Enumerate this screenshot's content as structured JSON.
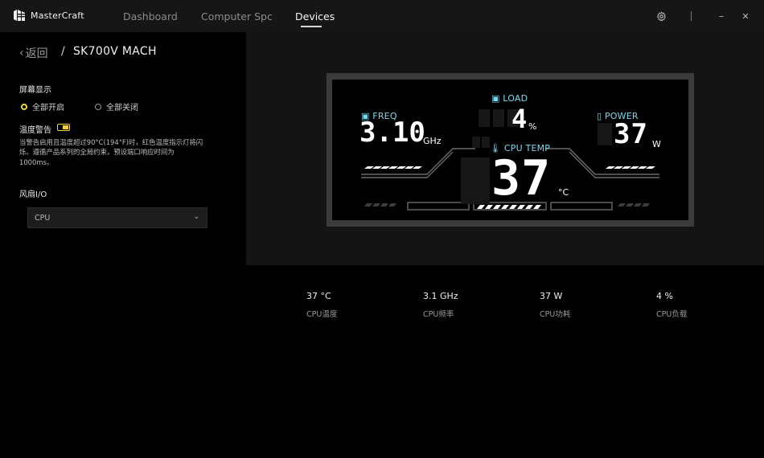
{
  "app": {
    "name": "MasterCraft"
  },
  "nav": {
    "dashboard": "Dashboard",
    "computer_spc": "Computer Spc",
    "devices": "Devices"
  },
  "window": {
    "settings_icon": "gear-icon",
    "minimize": "–",
    "close": "✕"
  },
  "breadcrumb": {
    "back": "返回",
    "separator": "/",
    "device": "SK700V MACH"
  },
  "screen_display": {
    "title": "屏幕显示",
    "option_on": "全部开启",
    "option_off": "全部关闭",
    "selected": "全部开启"
  },
  "temp_warning": {
    "title": "温度警告",
    "enabled": true,
    "description": "当警告启用且温度超过90°C(194°F)时，红色温度指示灯将闪烁。遵循产品系列的全局约束，预设端口响应时间为1000ms。"
  },
  "fan_io": {
    "title": "风扇I/O",
    "selected": "CPU"
  },
  "lcd": {
    "freq_label": "FREQ",
    "freq_value": "3.10",
    "freq_unit": "GHz",
    "load_label": "LOAD",
    "load_value": "4",
    "load_unit": "%",
    "power_label": "POWER",
    "power_value": "37",
    "power_unit": "W",
    "temp_label": "CPU TEMP",
    "temp_value": "37",
    "temp_unit": "°C",
    "accent_color": "#7ad8ee"
  },
  "stats": [
    {
      "value": "37 °C",
      "label": "CPU温度"
    },
    {
      "value": "3.1 GHz",
      "label": "CPU频率"
    },
    {
      "value": "37 W",
      "label": "CPU功耗"
    },
    {
      "value": "4 %",
      "label": "CPU负载"
    }
  ],
  "colors": {
    "accent_yellow": "#f3d23a",
    "lcd_cyan": "#7ad8ee"
  }
}
